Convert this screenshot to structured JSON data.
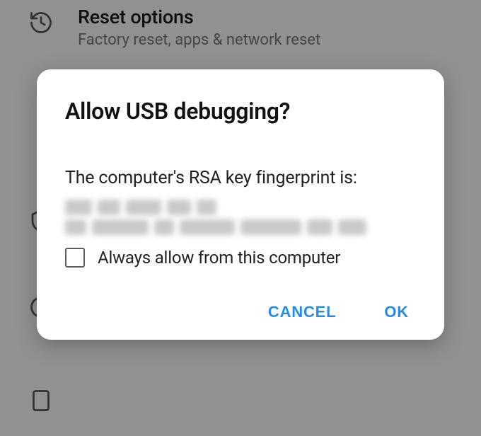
{
  "background": {
    "reset": {
      "title": "Reset options",
      "subtitle": "Factory reset, apps & network reset"
    }
  },
  "dialog": {
    "title": "Allow USB debugging?",
    "body": "The computer's RSA key fingerprint is:",
    "checkbox_label": "Always allow from this computer",
    "checkbox_checked": false,
    "cancel": "CANCEL",
    "ok": "OK"
  }
}
